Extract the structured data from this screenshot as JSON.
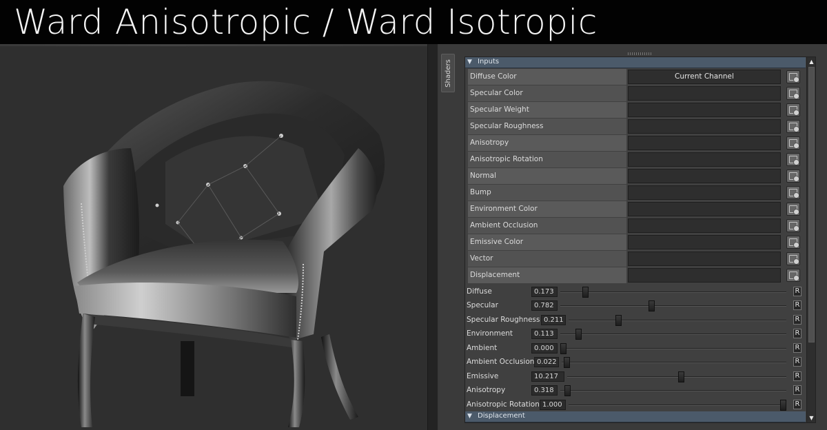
{
  "banner": {
    "title": "Ward Anisotropic / Ward Isotropic"
  },
  "panel": {
    "side_tab_label": "Shaders",
    "inputs_header": "Inputs",
    "inputs": [
      {
        "label": "Diffuse Color",
        "value": "Current Channel"
      },
      {
        "label": "Specular Color",
        "value": ""
      },
      {
        "label": "Specular Weight",
        "value": ""
      },
      {
        "label": "Specular Roughness",
        "value": ""
      },
      {
        "label": "Anisotropy",
        "value": ""
      },
      {
        "label": "Anisotropic Rotation",
        "value": ""
      },
      {
        "label": "Normal",
        "value": ""
      },
      {
        "label": "Bump",
        "value": ""
      },
      {
        "label": "Environment Color",
        "value": ""
      },
      {
        "label": "Ambient Occlusion",
        "value": ""
      },
      {
        "label": "Emissive Color",
        "value": ""
      },
      {
        "label": "Vector",
        "value": ""
      },
      {
        "label": "Displacement",
        "value": ""
      }
    ],
    "sliders": [
      {
        "label": "Diffuse",
        "value": "0.173",
        "fraction": 0.1
      },
      {
        "label": "Specular",
        "value": "0.782",
        "fraction": 0.4
      },
      {
        "label": "Specular Roughness",
        "value": "0.211",
        "fraction": 0.22
      },
      {
        "label": "Environment",
        "value": "0.113",
        "fraction": 0.07
      },
      {
        "label": "Ambient",
        "value": "0.000",
        "fraction": 0.0
      },
      {
        "label": "Ambient Occlusion",
        "value": "0.022",
        "fraction": 0.01
      },
      {
        "label": "Emissive",
        "value": "10.217",
        "fraction": 0.52
      },
      {
        "label": "Anisotropy",
        "value": "0.318",
        "fraction": 0.02
      },
      {
        "label": "Anisotropic Rotation",
        "value": "1.000",
        "fraction": 1.0
      }
    ],
    "reset_label": "R",
    "displacement_header": "Displacement"
  }
}
